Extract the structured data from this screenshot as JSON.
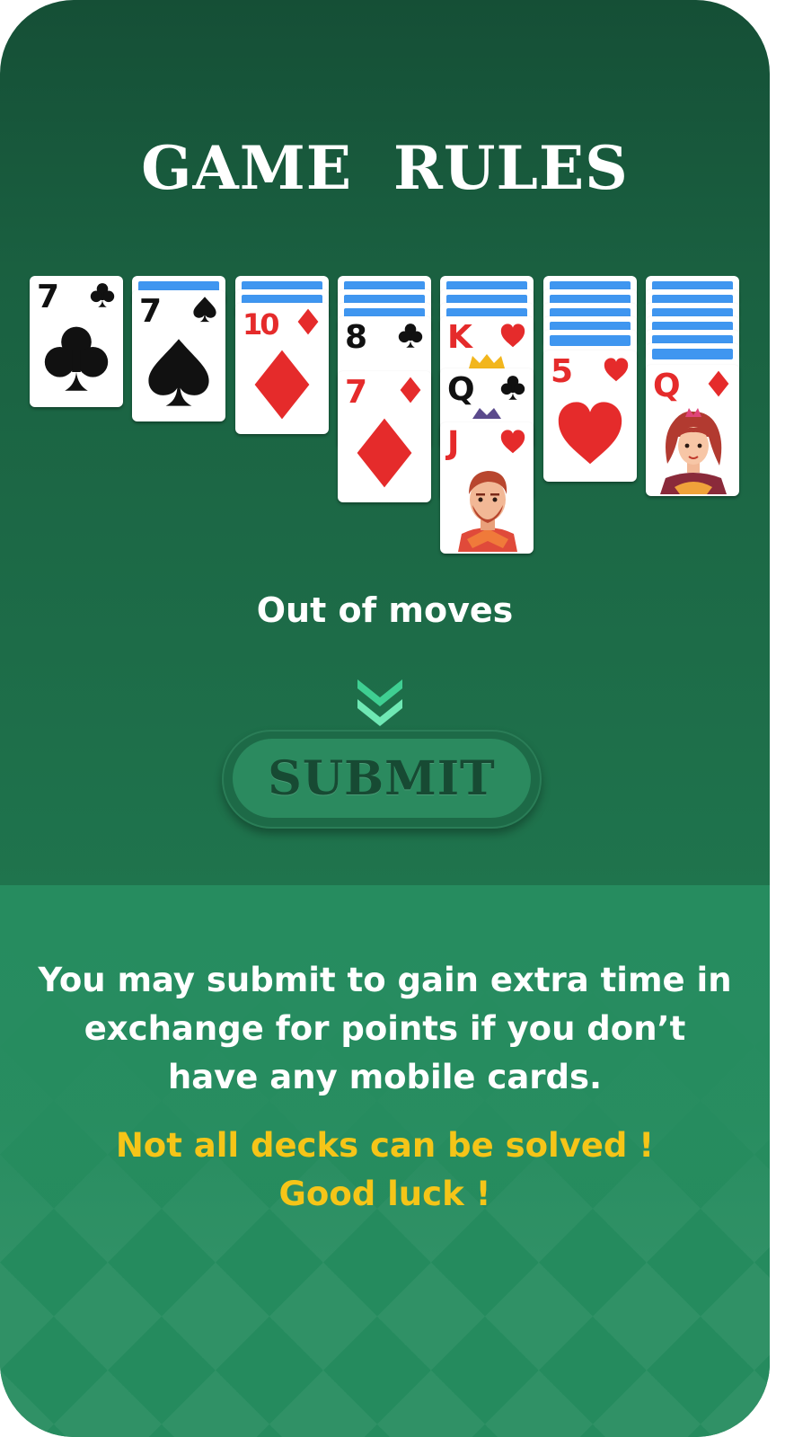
{
  "title": "GAME RULES",
  "tableau": [
    {
      "column": 1,
      "face_down": 0,
      "face_up": [
        {
          "rank": "7",
          "suit": "clubs"
        }
      ]
    },
    {
      "column": 2,
      "face_down": 1,
      "face_up": [
        {
          "rank": "7",
          "suit": "spades"
        }
      ]
    },
    {
      "column": 3,
      "face_down": 2,
      "face_up": [
        {
          "rank": "10",
          "suit": "diamonds"
        }
      ]
    },
    {
      "column": 4,
      "face_down": 3,
      "face_up": [
        {
          "rank": "8",
          "suit": "clubs"
        },
        {
          "rank": "7",
          "suit": "diamonds"
        }
      ]
    },
    {
      "column": 5,
      "face_down": 3,
      "face_up": [
        {
          "rank": "K",
          "suit": "hearts"
        },
        {
          "rank": "Q",
          "suit": "clubs"
        },
        {
          "rank": "J",
          "suit": "hearts"
        }
      ]
    },
    {
      "column": 6,
      "face_down": 5,
      "face_up": [
        {
          "rank": "5",
          "suit": "hearts"
        }
      ]
    },
    {
      "column": 7,
      "face_down": 6,
      "face_up": [
        {
          "rank": "Q",
          "suit": "diamonds"
        }
      ]
    }
  ],
  "cards": {
    "c1": {
      "rank": "7"
    },
    "c2": {
      "rank": "7"
    },
    "c3": {
      "rank": "10"
    },
    "c4a": {
      "rank": "8"
    },
    "c4b": {
      "rank": "7"
    },
    "c5a": {
      "rank": "K"
    },
    "c5b": {
      "rank": "Q"
    },
    "c5c": {
      "rank": "J"
    },
    "c6": {
      "rank": "5"
    },
    "c7": {
      "rank": "Q"
    }
  },
  "status_text": "Out of moves",
  "submit_label": "SUBMIT",
  "rules_text": "You may submit to gain extra time in exchange for points if you don’t have any mobile cards.",
  "note_line1": "Not all decks can be solved !",
  "note_line2": "Good luck !",
  "colors": {
    "panel_top": "#154f36",
    "panel_bottom": "#258b5e",
    "accent_yellow": "#f5c518",
    "card_back_blue": "#3f96f0",
    "red_suit": "#e52b2b"
  },
  "icons": [
    "clubs-icon",
    "spades-icon",
    "diamonds-icon",
    "hearts-icon",
    "double-chevron-down-icon",
    "king-face-icon",
    "queen-face-icon",
    "jack-face-icon"
  ]
}
